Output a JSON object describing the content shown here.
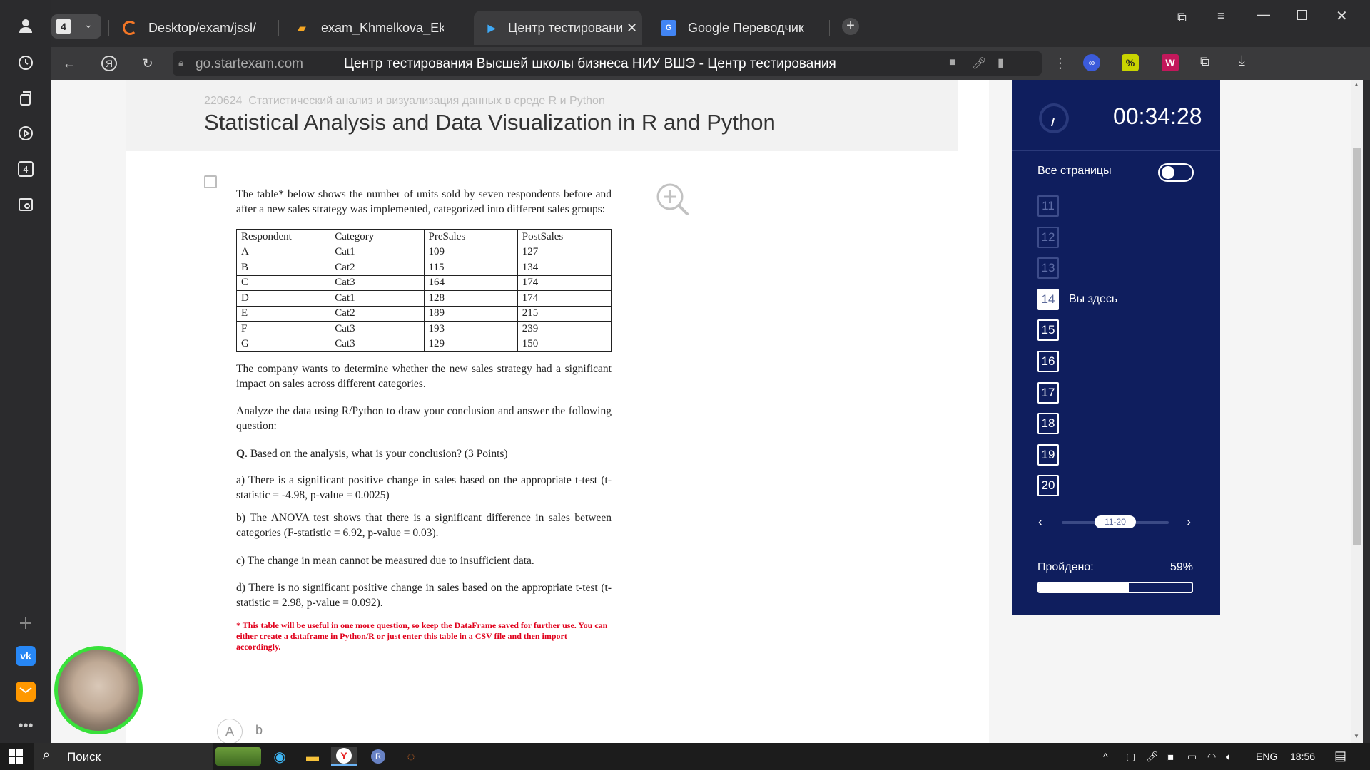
{
  "browser": {
    "tab_count": "4",
    "tabs": [
      {
        "label": "Desktop/exam/jssl/",
        "icon": "spinner-icon"
      },
      {
        "label": "exam_Khmelkova_Ekaterin",
        "icon": "document-icon"
      },
      {
        "label": "Центр тестирования Вь",
        "icon": "play-icon"
      },
      {
        "label": "Google Переводчик",
        "icon": "translate-icon"
      }
    ],
    "url": "go.startexam.com",
    "page_title": "Центр тестирования Высшей школы бизнеса НИУ ВШЭ - Центр тестирования"
  },
  "sidebar": {
    "badge": "4"
  },
  "exam": {
    "subtitle": "220624_Статистический анализ и визуализация данных в среде R и Python",
    "title": "Statistical Analysis and Data Visualization in R and Python"
  },
  "question": {
    "intro": "The table* below shows the number of units sold by seven respondents before and after a new sales strategy was implemented, categorized into different sales groups:",
    "table": {
      "headers": [
        "Respondent",
        "Category",
        "PreSales",
        "PostSales"
      ],
      "rows": [
        [
          "A",
          "Cat1",
          "109",
          "127"
        ],
        [
          "B",
          "Cat2",
          "115",
          "134"
        ],
        [
          "C",
          "Cat3",
          "164",
          "174"
        ],
        [
          "D",
          "Cat1",
          "128",
          "174"
        ],
        [
          "E",
          "Cat2",
          "189",
          "215"
        ],
        [
          "F",
          "Cat3",
          "193",
          "239"
        ],
        [
          "G",
          "Cat3",
          "129",
          "150"
        ]
      ]
    },
    "p1": "The company wants to determine whether the new sales strategy had a significant impact on sales across different categories.",
    "p2": "Analyze the data using R/Python to draw your conclusion and answer the following question:",
    "q_label": "Q.",
    "q_text": " Based on the analysis, what is your conclusion? (3 Points)",
    "options": [
      "a) There is a significant positive change in sales based on the appropriate t-test  (t-statistic = -4.98, p-value = 0.0025)",
      "b) The ANOVA test shows that there is a significant difference in sales between categories (F-statistic = 6.92, p-value = 0.03).",
      "c) The change in mean cannot be measured due to insufficient data.",
      "d) There is no significant positive change in sales based on the appropriate t-test (t-statistic = 2.98, p-value = 0.092)."
    ],
    "note": "* This table will be useful in one more question, so keep the DataFrame saved for further use. You can either create a dataframe in Python/R or just enter this table in a CSV file and then import accordingly.",
    "answer_letter": "A",
    "answer_text": "b"
  },
  "panel": {
    "timer": "00:34:28",
    "all_pages": "Все страницы",
    "pages": [
      "11",
      "12",
      "13",
      "14",
      "15",
      "16",
      "17",
      "18",
      "19",
      "20"
    ],
    "current_page": "14",
    "you_are_here": "Вы здесь",
    "range_label": "11-20",
    "passed_label": "Пройдено:",
    "passed_value": "59%",
    "passed_fraction": 0.59
  },
  "taskbar": {
    "search": "Поиск",
    "lang": "ENG",
    "time": "18:56"
  },
  "colors": {
    "panel_bg": "#0f1e5e",
    "note_red": "#e0001b",
    "webcam_ring": "#38e13a"
  }
}
